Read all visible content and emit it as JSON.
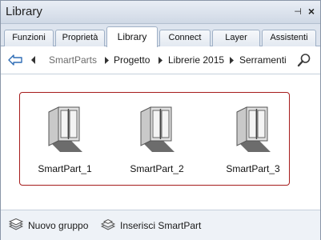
{
  "panel": {
    "title": "Library",
    "pin_glyph": "⊣",
    "close_glyph": "×"
  },
  "tabs": [
    {
      "label": "Funzioni",
      "active": false
    },
    {
      "label": "Proprietà",
      "active": false
    },
    {
      "label": "Library",
      "active": true
    },
    {
      "label": "Connect",
      "active": false
    },
    {
      "label": "Layer",
      "active": false
    },
    {
      "label": "Assistenti",
      "active": false
    }
  ],
  "nav": {
    "back_icon": "back-arrow-icon",
    "history_icon": "history-left-icon",
    "search_icon": "magnifier-icon",
    "breadcrumb": [
      "SmartParts",
      "Progetto",
      "Librerie 2015",
      "Serramenti"
    ]
  },
  "items": [
    {
      "label": "SmartPart_1",
      "icon": "window-frame-icon"
    },
    {
      "label": "SmartPart_2",
      "icon": "window-frame-icon"
    },
    {
      "label": "SmartPart_3",
      "icon": "window-frame-icon"
    }
  ],
  "bottom": {
    "new_group_label": "Nuovo gruppo",
    "insert_label": "Inserisci SmartPart"
  },
  "colors": {
    "selection_border": "#a61c1c",
    "title_bar": "#dbe2ec",
    "back_arrow": "#2f6db5"
  }
}
